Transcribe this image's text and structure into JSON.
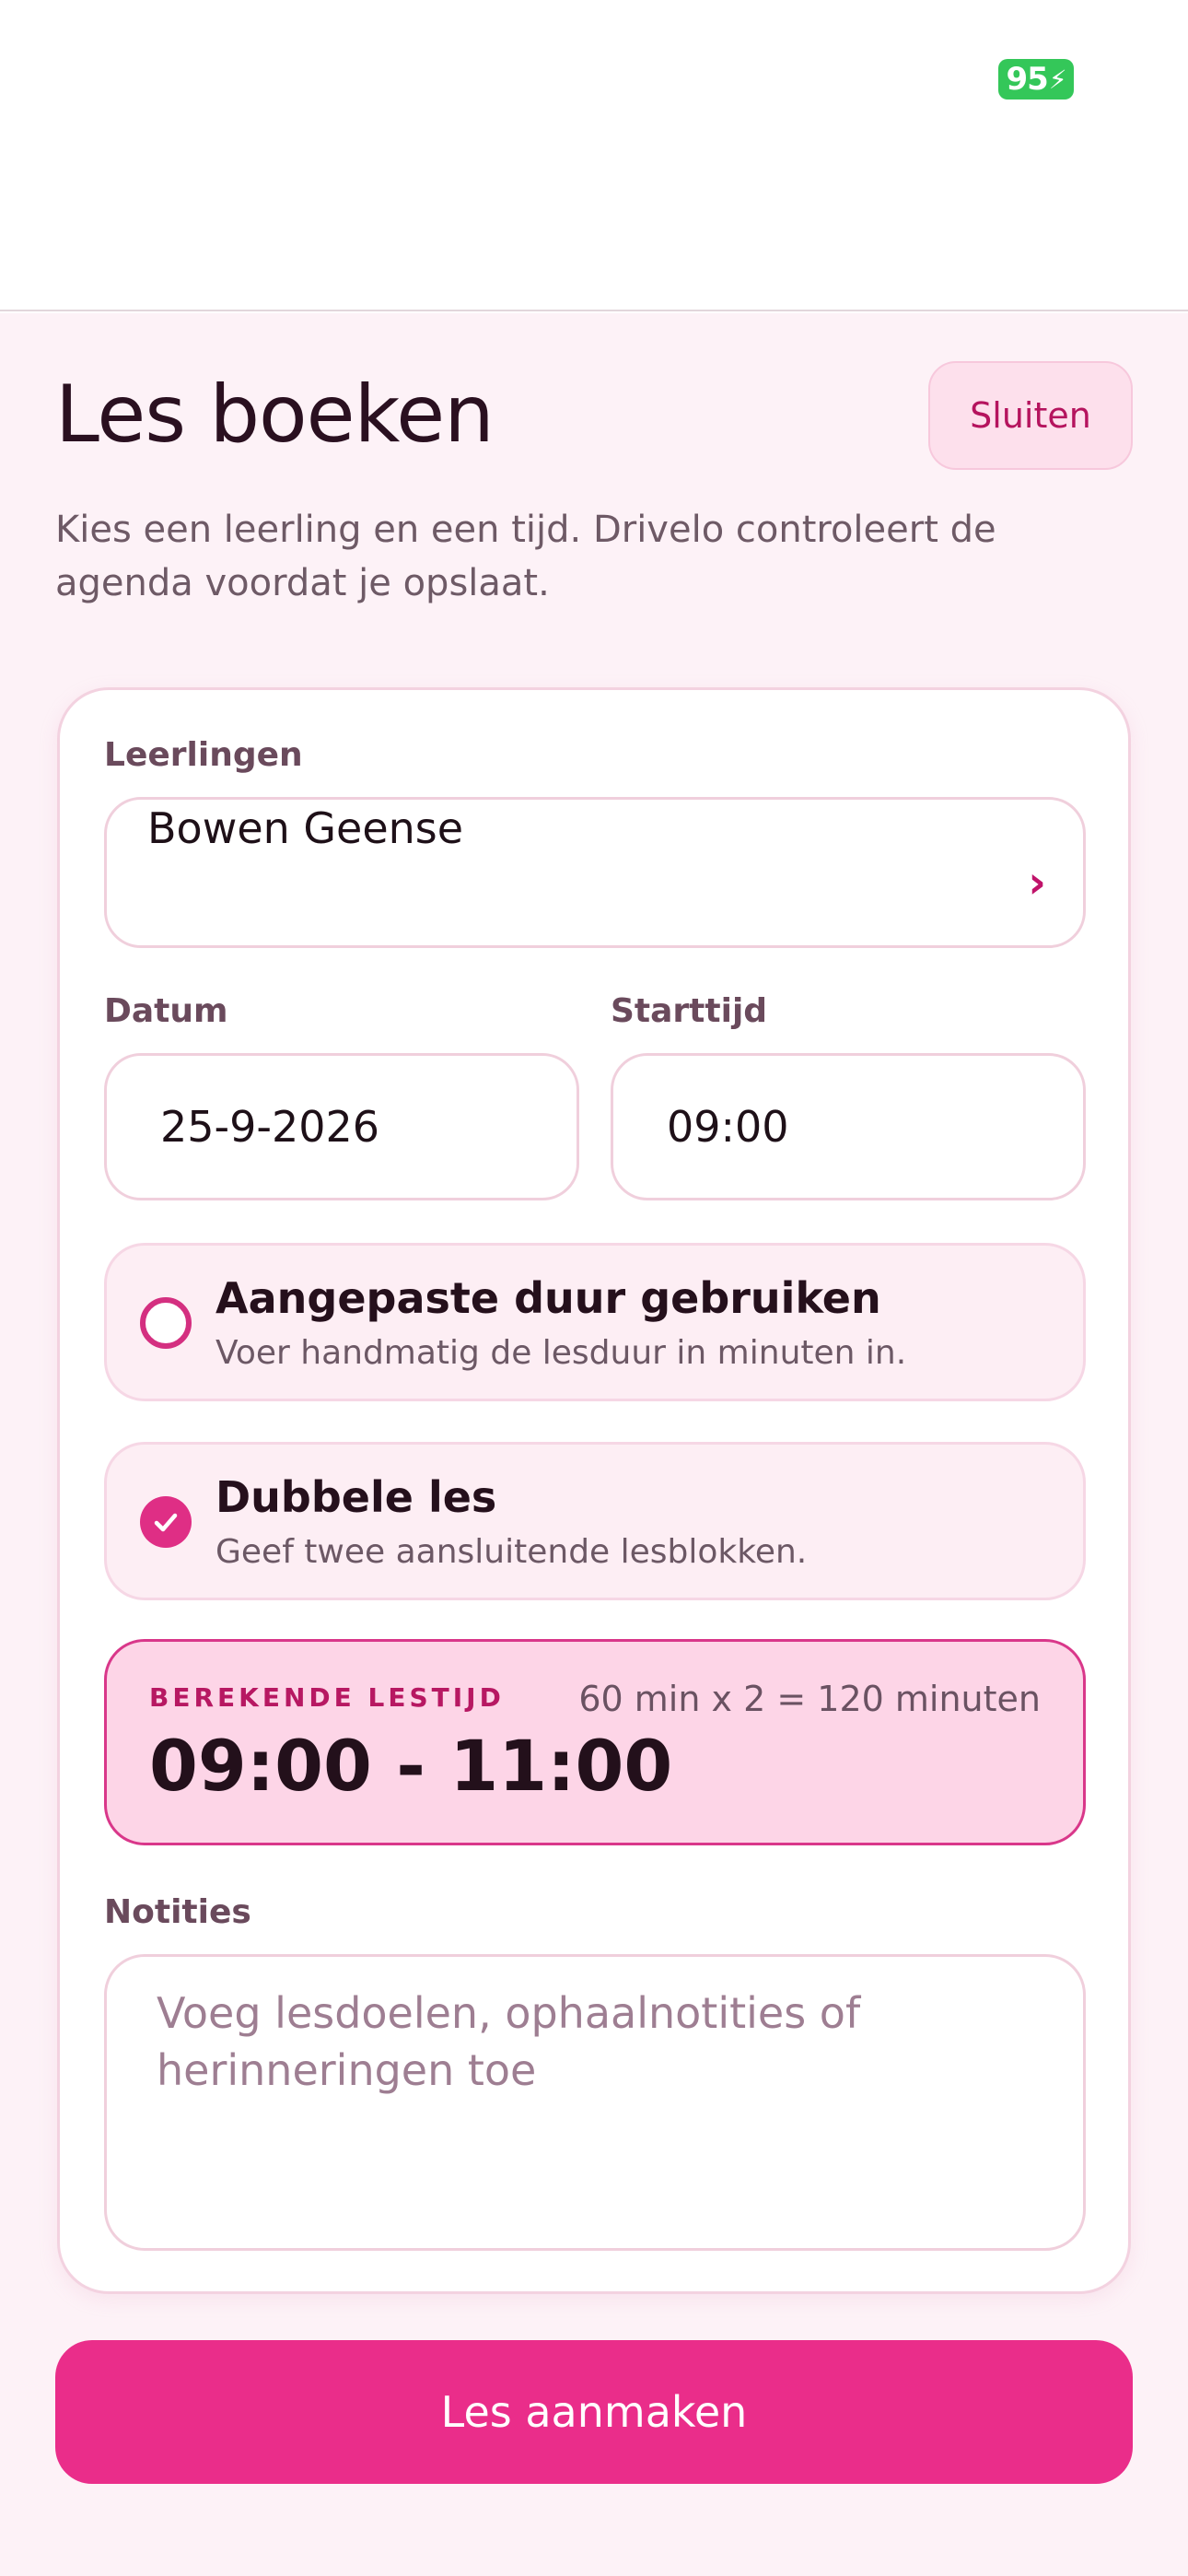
{
  "status": {
    "battery": "95"
  },
  "header": {
    "title": "Les boeken",
    "close_label": "Sluiten",
    "subtitle": "Kies een leerling en een tijd. Drivelo controleert de agenda voordat je opslaat."
  },
  "form": {
    "students_label": "Leerlingen",
    "student_value": "Bowen Geense",
    "date_label": "Datum",
    "date_value": "25-9-2026",
    "start_label": "Starttijd",
    "start_value": "09:00",
    "custom_duration": {
      "title": "Aangepaste duur gebruiken",
      "description": "Voer handmatig de lesduur in minuten in.",
      "checked": false
    },
    "double_lesson": {
      "title": "Dubbele les",
      "description": "Geef twee aansluitende lesblokken.",
      "checked": true
    },
    "calculated": {
      "label": "BEREKENDE LESTIJD",
      "formula": "60 min x 2 = 120 minuten",
      "range": "09:00 - 11:00"
    },
    "notes_label": "Notities",
    "notes_placeholder": "Voeg lesdoelen, ophaalnotities of herinneringen toe"
  },
  "actions": {
    "create_label": "Les aanmaken"
  },
  "colors": {
    "accent": "#ea2d8a",
    "accent_dark": "#b5145e",
    "background": "#fdf2f7",
    "highlight": "#fdd5e7"
  },
  "icons": {
    "battery": "battery-charging-icon",
    "chevron": "chevron-right-icon",
    "radio": "radio-empty-icon",
    "check": "check-circle-icon"
  }
}
